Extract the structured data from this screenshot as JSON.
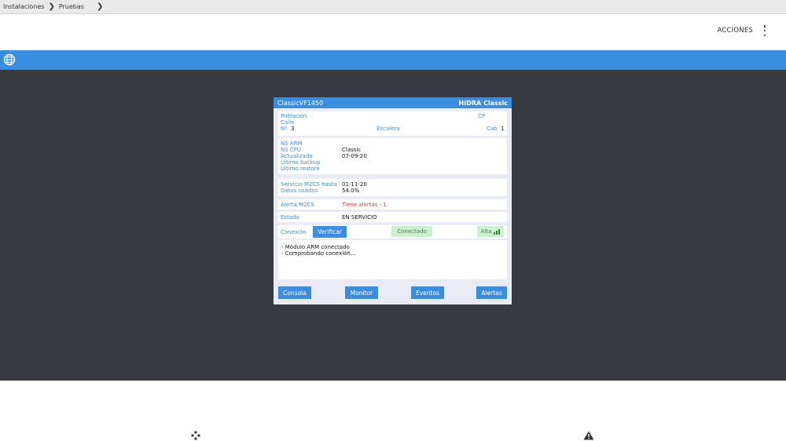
{
  "breadcrumb": {
    "items": [
      "Instalaciones",
      "Pruebas"
    ],
    "separator_icon": "chevron-right-icon"
  },
  "header": {
    "actions_label": "ACCIONES",
    "menu_icon": "kebab-menu-icon"
  },
  "toolbar": {
    "globe_icon": "globe-icon",
    "accent_color": "#3b8de0"
  },
  "device": {
    "model": "ClassicVF1450",
    "brand": "HIDRA Classic",
    "address": {
      "poblacion_label": "Población",
      "cp_label": "CP",
      "calle_label": "Calle",
      "numero_label": "Nº",
      "numero_value": "3",
      "escalera_label": "Escalera",
      "cab_label": "Cab",
      "cab_value": "1"
    },
    "info": {
      "ns_arm_label": "NS ARM",
      "ns_cpu_label": "NS CPU",
      "ns_cpu_value": "Classic",
      "actualizado_label": "Actualizado",
      "actualizado_value": "07-09-20",
      "ultimo_backup_label": "Último backup",
      "ultimo_restore_label": "Último restore"
    },
    "service": {
      "servicio_label": "Servicio M2CS hasta",
      "servicio_value": "01-11-20",
      "datos_label": "Datos usados",
      "datos_value": "54.0%"
    },
    "alert": {
      "label": "Alerta M2CS",
      "value": "Tiene alertas - 1",
      "color": "#e53935"
    },
    "estado": {
      "label": "Estado",
      "value": "EN SERVICIO"
    },
    "connection": {
      "label": "Conexión",
      "verify_button": "Verificar",
      "status": "Conectado",
      "signal_label": "Alta",
      "signal_icon": "signal-bars-icon"
    },
    "log_lines": [
      "- Módulo ARM conectado",
      "- Comprobando conexión..."
    ],
    "buttons": {
      "consola": "Consola",
      "monitor": "Monitor",
      "eventos": "Eventos",
      "alertas": "Alertas"
    }
  },
  "bottom": {
    "left_icon": "move-arrows-icon",
    "right_icon": "warning-icon"
  }
}
